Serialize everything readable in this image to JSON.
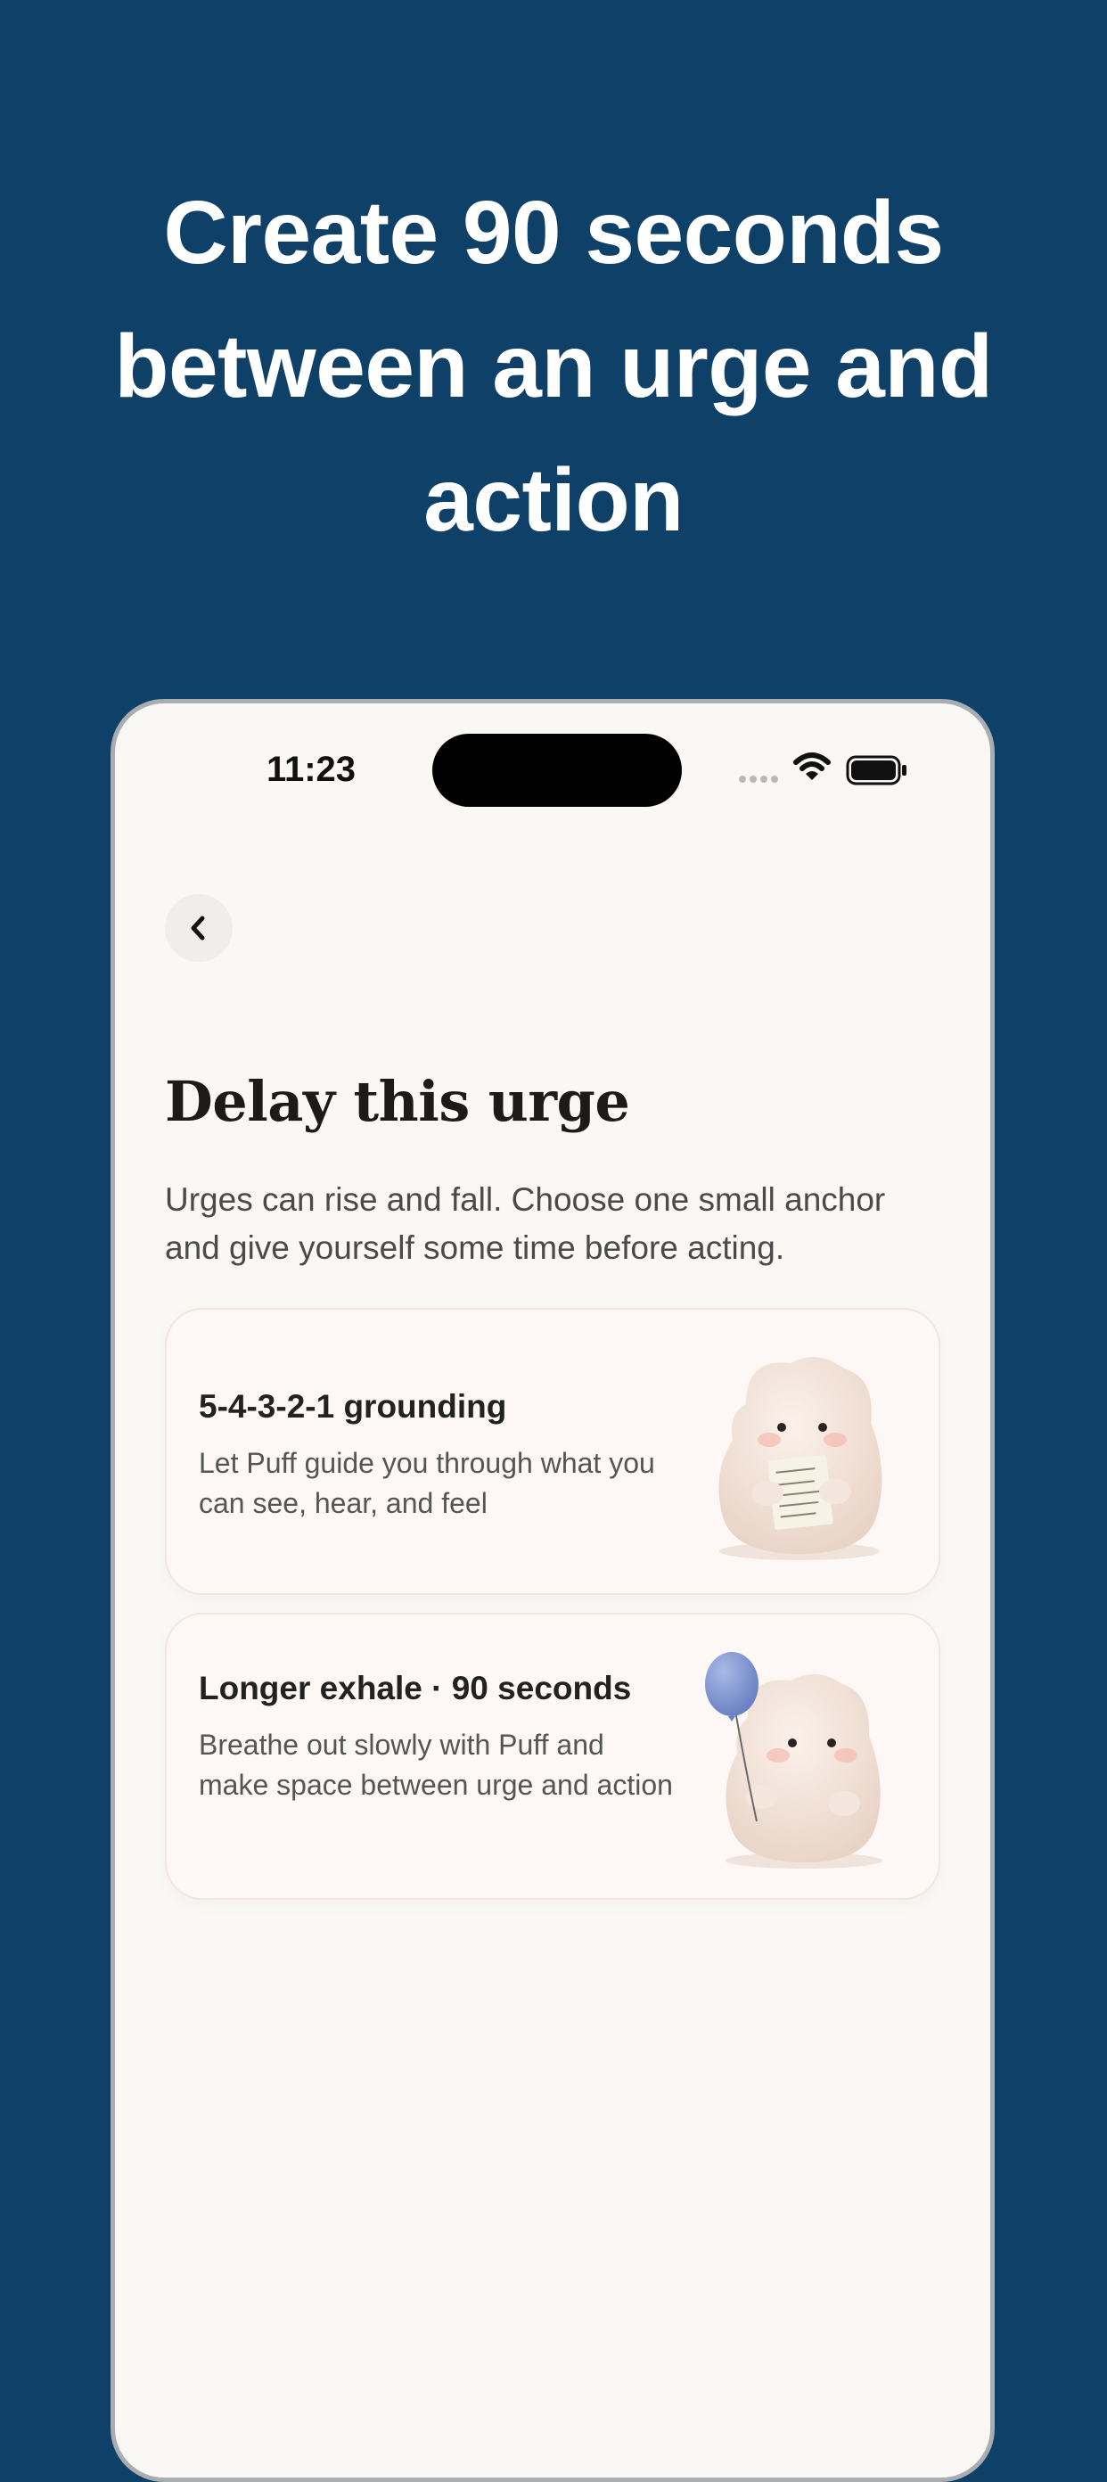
{
  "headline": "Create 90 seconds between an urge and action",
  "status_bar": {
    "time": "11:23"
  },
  "screen": {
    "title": "Delay this urge",
    "subtitle": "Urges can rise and fall. Choose one small anchor and give yourself some time before acting.",
    "options": [
      {
        "title": "5-4-3-2-1 grounding",
        "description": "Let Puff guide you through what you can see, hear, and feel",
        "illustration": "puff-holding-note"
      },
      {
        "title": "Longer exhale · 90 seconds",
        "description": "Breathe out slowly with Puff and make space between urge and action",
        "illustration": "puff-holding-balloon"
      }
    ]
  },
  "colors": {
    "background": "#0f4068",
    "screen_bg": "#faf8f5",
    "card_bg": "#fdf8f5",
    "balloon": "#7e95cf"
  }
}
